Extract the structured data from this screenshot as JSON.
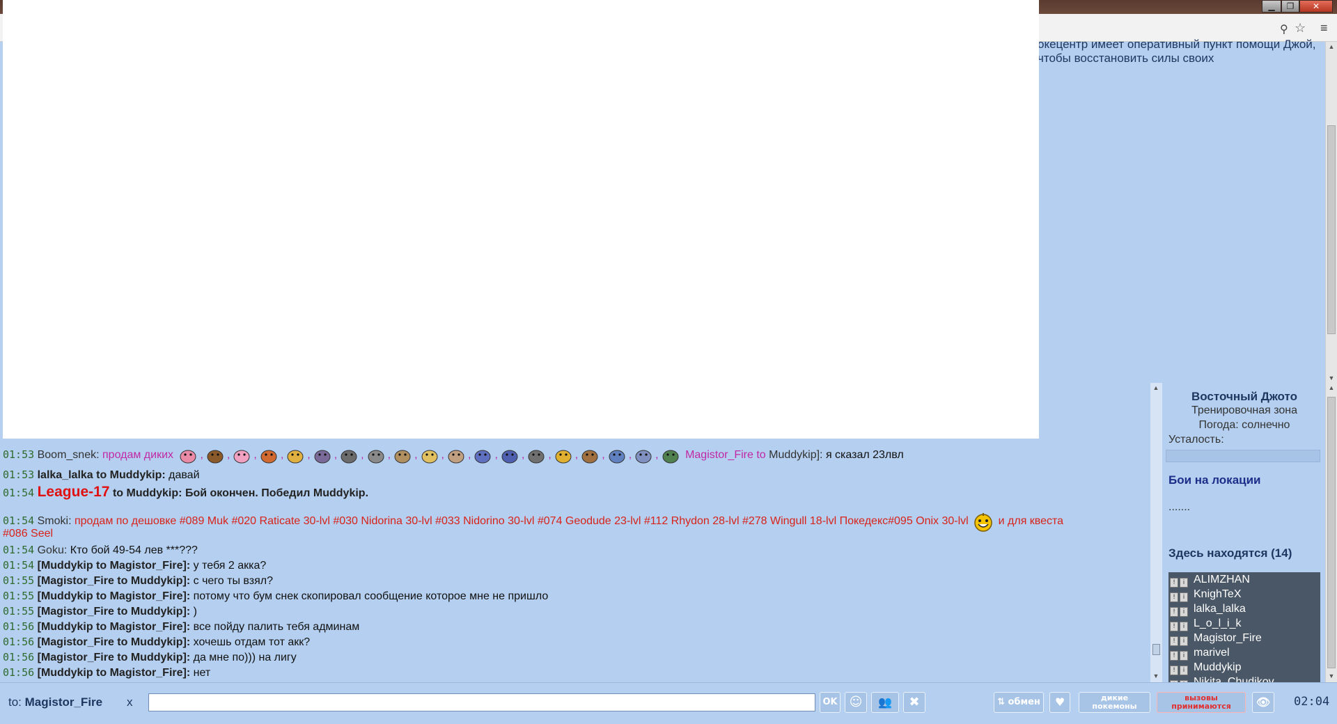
{
  "window": {
    "controls": {
      "minimize": "▁",
      "maximize": "❐",
      "close": "✕"
    }
  },
  "toolbar": {
    "zoom_icon": "⚲",
    "star_icon": "☆",
    "menu_icon": "≡"
  },
  "location_description": "окецентр имеет оперативный пункт помощи Джой, чтобы восстановить силы своих",
  "chat": {
    "lines": [
      {
        "time": "01:53",
        "user": "Boom_snek:",
        "text": "продам диких",
        "sprites": 19,
        "pm_from": "Magistor_Fire to",
        "pm_to": "Muddykip]:",
        "tail": "я сказал 23лвл"
      },
      {
        "time": "01:53",
        "user": "lalka_lalka to Muddykip:",
        "text": "давай"
      },
      {
        "time": "01:54",
        "user": "League-17",
        "to": "to Muddykip:",
        "text": "Бой окончен. Победил Muddykip."
      },
      {
        "time": "01:54",
        "user": "Smoki:",
        "text": "продам по дешовке #089 Muk #020 Raticate 30-lvl #030 Nidorina 30-lvl #033 Nidorino 30-lvl #074 Geodude 23-lvl #112 Rhydon 28-lvl #278 Wingull 18-lvl Покедекс#095 Onix 30-lvl",
        "tail": "и для квеста",
        "cont": "#086 Seel"
      },
      {
        "time": "01:54",
        "user": "Goku:",
        "text": "Кто бой 49-54 лев ***???"
      },
      {
        "time": "01:54",
        "user": "[Muddykip to Magistor_Fire]:",
        "text": "у тебя 2 акка?"
      },
      {
        "time": "01:55",
        "user": "[Magistor_Fire to Muddykip]:",
        "text": "с чего ты взял?"
      },
      {
        "time": "01:55",
        "user": "[Muddykip to Magistor_Fire]:",
        "text": "потому что бум снек скопировал сообщение которое мне не пришло"
      },
      {
        "time": "01:55",
        "user": "[Magistor_Fire to Muddykip]:",
        "text": ")"
      },
      {
        "time": "01:56",
        "user": "[Muddykip to Magistor_Fire]:",
        "text": "все пойду палить тебя админам"
      },
      {
        "time": "01:56",
        "user": "[Magistor_Fire to Muddykip]:",
        "text": "хочешь отдам тот акк?"
      },
      {
        "time": "01:56",
        "user": "[Magistor_Fire to Muddykip]:",
        "text": "да мне по))) на лигу"
      },
      {
        "time": "01:56",
        "user": "[Muddykip to Magistor_Fire]:",
        "text": "нет"
      }
    ]
  },
  "right_panel": {
    "location": "Восточный Джото",
    "zone": "Тренировочная зона",
    "weather": "Погода: солнечно",
    "fatigue_label": "Усталость:",
    "battles_title": "Бои на локации",
    "battles_value": ".......",
    "here_title": "Здесь находятся (14)",
    "users": [
      "ALIMZHAN",
      "KnighTeX",
      "lalka_lalka",
      "L_o_l_i_k",
      "Magistor_Fire",
      "marivel",
      "Muddykip",
      "Nikita_Chudikov"
    ]
  },
  "bottom": {
    "to_prefix": "to:",
    "to_name": "Magistor_Fire",
    "clear": "x",
    "input_value": "",
    "ok": "OK",
    "smile": "☺",
    "group": "👥",
    "x_btn": "✖",
    "trade": "⇅ обмен",
    "heart": "♥",
    "wild_line1": "дикие",
    "wild_line2": "покемоны",
    "calls_line1": "вызовы",
    "calls_line2": "принимаются",
    "eye": "👁",
    "clock": "02:04"
  },
  "colors": {
    "background": "#b4cfef",
    "accent": "#1e3760",
    "league": "#e01010",
    "pink": "#c228a6",
    "time": "#2f6b2f"
  }
}
